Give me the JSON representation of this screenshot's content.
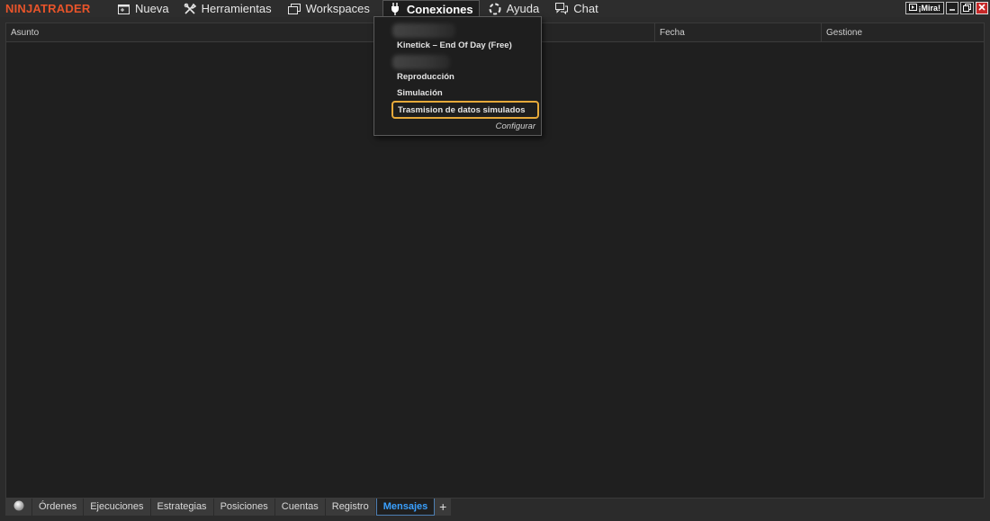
{
  "app": {
    "logo": "NINJATRADER"
  },
  "menu": {
    "nueva": "Nueva",
    "herramientas": "Herramientas",
    "workspaces": "Workspaces",
    "conexiones": "Conexiones",
    "ayuda": "Ayuda",
    "chat": "Chat"
  },
  "window_controls": {
    "mira": "¡Mira!"
  },
  "grid": {
    "columns": [
      "Asunto",
      "Fecha",
      "Gestione"
    ]
  },
  "dropdown": {
    "items": [
      "Kinetick – End Of Day (Free)",
      "Reproducción",
      "Simulación",
      "Trasmision de datos simulados"
    ],
    "configure": "Configurar"
  },
  "tabs": [
    "Órdenes",
    "Ejecuciones",
    "Estrategias",
    "Posiciones",
    "Cuentas",
    "Registro",
    "Mensajes"
  ],
  "tab_add": "+",
  "colors": {
    "logo": "#e8542a",
    "highlight_border": "#e6a93a",
    "active_tab": "#3aa0ff",
    "close_button": "#c62828"
  }
}
